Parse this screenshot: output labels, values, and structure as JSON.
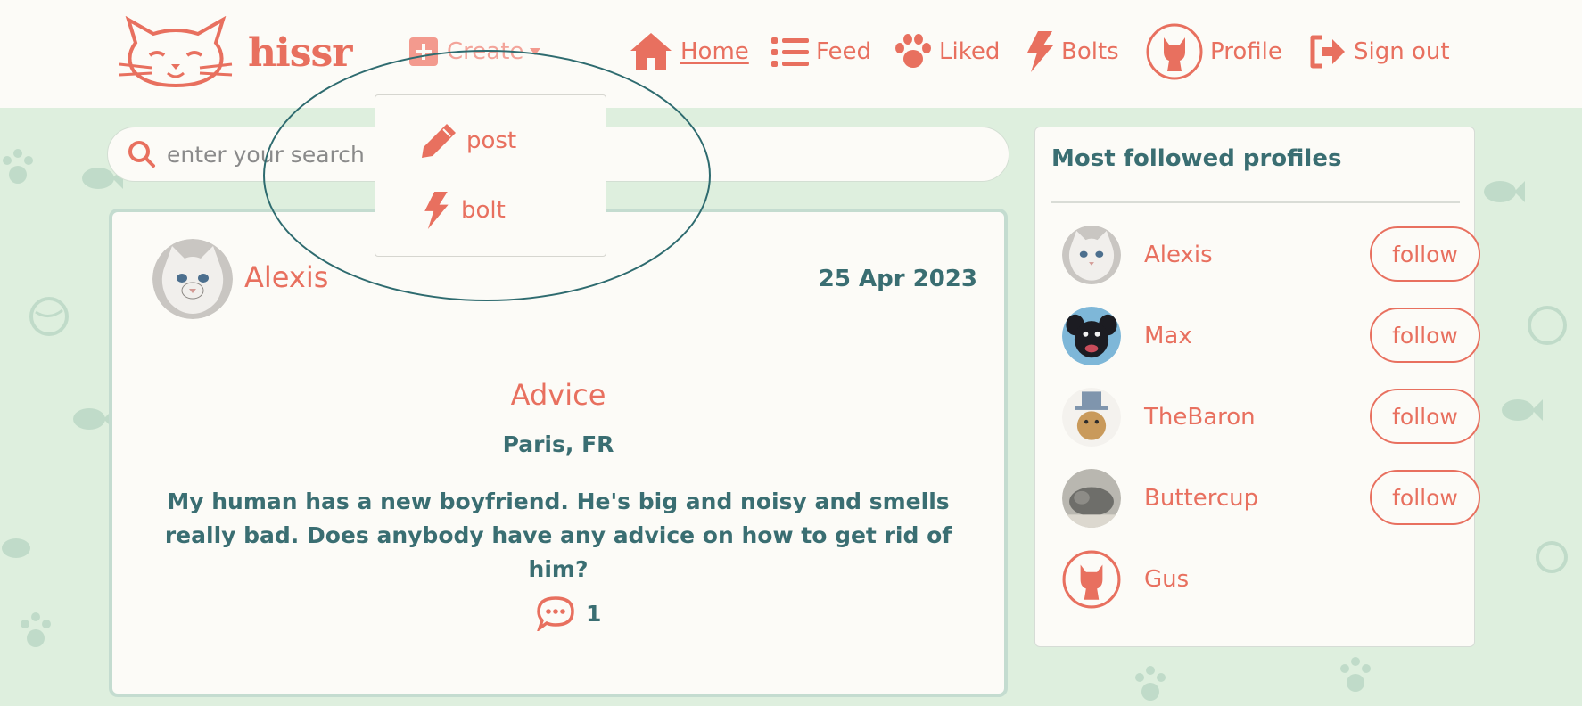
{
  "brand": {
    "name": "hissr",
    "logo_icon": "cat-face-logo"
  },
  "nav": {
    "create_label": "Create",
    "home_label": "Home",
    "feed_label": "Feed",
    "liked_label": "Liked",
    "bolts_label": "Bolts",
    "profile_label": "Profile",
    "signout_label": "Sign out"
  },
  "create_menu": {
    "items": [
      {
        "label": "post",
        "icon": "pencil-icon"
      },
      {
        "label": "bolt",
        "icon": "bolt-icon"
      }
    ]
  },
  "search": {
    "placeholder": "enter your search"
  },
  "post": {
    "author": "Alexis",
    "date": "25 Apr 2023",
    "title": "Advice",
    "location": "Paris, FR",
    "body": "My human has a new boyfriend. He's big and noisy and smells really bad. Does anybody have any advice on how to get rid of him?",
    "comment_count": "1"
  },
  "sidebar": {
    "title": "Most followed profiles",
    "follow_label": "follow",
    "profiles": [
      {
        "name": "Alexis",
        "avatar": "white-cat-photo"
      },
      {
        "name": "Max",
        "avatar": "black-dog-photo"
      },
      {
        "name": "TheBaron",
        "avatar": "cat-top-hat-photo"
      },
      {
        "name": "Buttercup",
        "avatar": "grey-cat-photo"
      },
      {
        "name": "Gus",
        "avatar": "default-cat-avatar-icon"
      }
    ]
  },
  "colors": {
    "accent": "#e8705f",
    "teal": "#3a6e72",
    "background": "#deefde",
    "card": "#fcfbf7",
    "highlight": "#2e6b6f"
  }
}
